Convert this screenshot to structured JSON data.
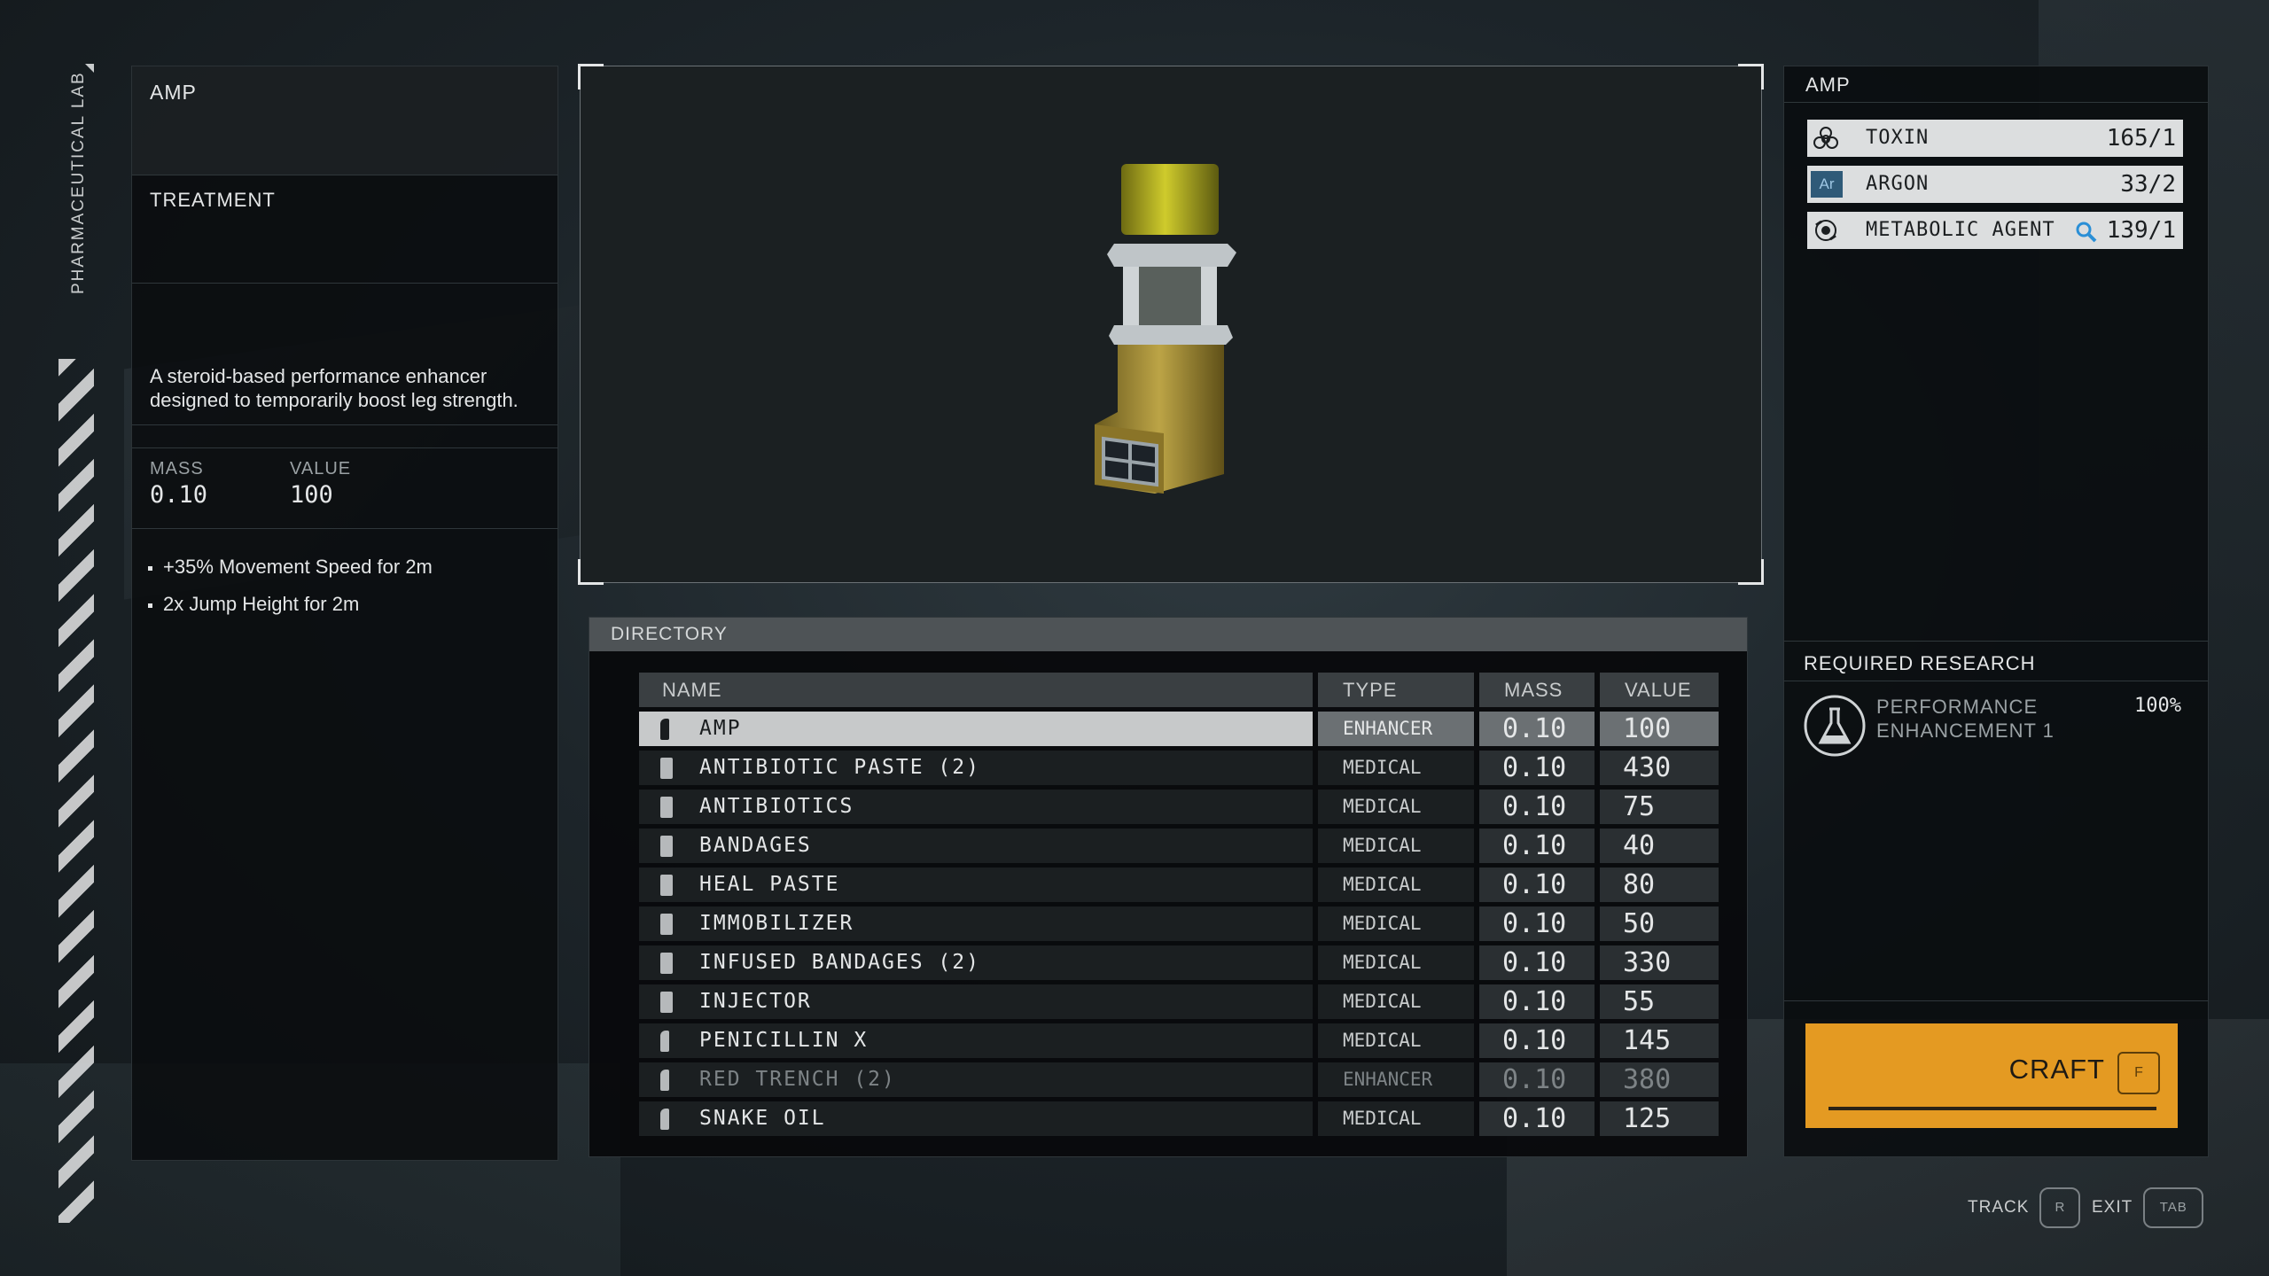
{
  "side": {
    "label": "PHARMACEUTICAL LAB"
  },
  "item": {
    "title": "AMP",
    "type": "TREATMENT",
    "description": "A steroid-based performance enhancer designed to temporarily boost leg strength.",
    "mass_label": "MASS",
    "mass": "0.10",
    "value_label": "VALUE",
    "value": "100",
    "effects": [
      "+35% Movement Speed for 2m",
      "2x Jump Height for 2m"
    ]
  },
  "directory": {
    "title": "DIRECTORY",
    "columns": [
      "NAME",
      "TYPE",
      "MASS",
      "VALUE"
    ],
    "rows": [
      {
        "name": "AMP",
        "type": "ENHANCER",
        "mass": "0.10",
        "value": "100",
        "icon": "bottle-icon",
        "state": "selected"
      },
      {
        "name": "ANTIBIOTIC PASTE (2)",
        "type": "MEDICAL",
        "mass": "0.10",
        "value": "430",
        "icon": "medkit-icon",
        "state": "normal"
      },
      {
        "name": "ANTIBIOTICS",
        "type": "MEDICAL",
        "mass": "0.10",
        "value": "75",
        "icon": "medkit-icon",
        "state": "normal"
      },
      {
        "name": "BANDAGES",
        "type": "MEDICAL",
        "mass": "0.10",
        "value": "40",
        "icon": "medkit-icon",
        "state": "normal"
      },
      {
        "name": "HEAL PASTE",
        "type": "MEDICAL",
        "mass": "0.10",
        "value": "80",
        "icon": "medkit-icon",
        "state": "normal"
      },
      {
        "name": "IMMOBILIZER",
        "type": "MEDICAL",
        "mass": "0.10",
        "value": "50",
        "icon": "medkit-icon",
        "state": "normal"
      },
      {
        "name": "INFUSED BANDAGES (2)",
        "type": "MEDICAL",
        "mass": "0.10",
        "value": "330",
        "icon": "medkit-icon",
        "state": "normal"
      },
      {
        "name": "INJECTOR",
        "type": "MEDICAL",
        "mass": "0.10",
        "value": "55",
        "icon": "medkit-icon",
        "state": "normal"
      },
      {
        "name": "PENICILLIN X",
        "type": "MEDICAL",
        "mass": "0.10",
        "value": "145",
        "icon": "bottle-icon",
        "state": "normal"
      },
      {
        "name": "RED TRENCH (2)",
        "type": "ENHANCER",
        "mass": "0.10",
        "value": "380",
        "icon": "bottle-icon",
        "state": "dim"
      },
      {
        "name": "SNAKE OIL",
        "type": "MEDICAL",
        "mass": "0.10",
        "value": "125",
        "icon": "bottle-icon",
        "state": "normal"
      }
    ]
  },
  "resources": {
    "title": "AMP",
    "items": [
      {
        "name": "TOXIN",
        "count": "165/1",
        "icon": "biohazard-icon"
      },
      {
        "name": "ARGON",
        "count": "33/2",
        "icon": "element-ar-icon",
        "symbol": "Ar"
      },
      {
        "name": "METABOLIC AGENT",
        "count": "139/1",
        "icon": "metabolic-agent-icon"
      }
    ]
  },
  "research": {
    "title": "REQUIRED RESEARCH",
    "name": "PERFORMANCE\nENHANCEMENT 1",
    "percent": "100%"
  },
  "actions": {
    "craft_label": "CRAFT",
    "craft_key": "F",
    "track_label": "TRACK",
    "track_key": "R",
    "exit_label": "EXIT",
    "exit_key": "TAB"
  },
  "colors": {
    "accent": "#e49a22",
    "selected_row": "#c7c9ca",
    "argon": "#2f5a78",
    "amp_yellow": "#b7b321"
  }
}
